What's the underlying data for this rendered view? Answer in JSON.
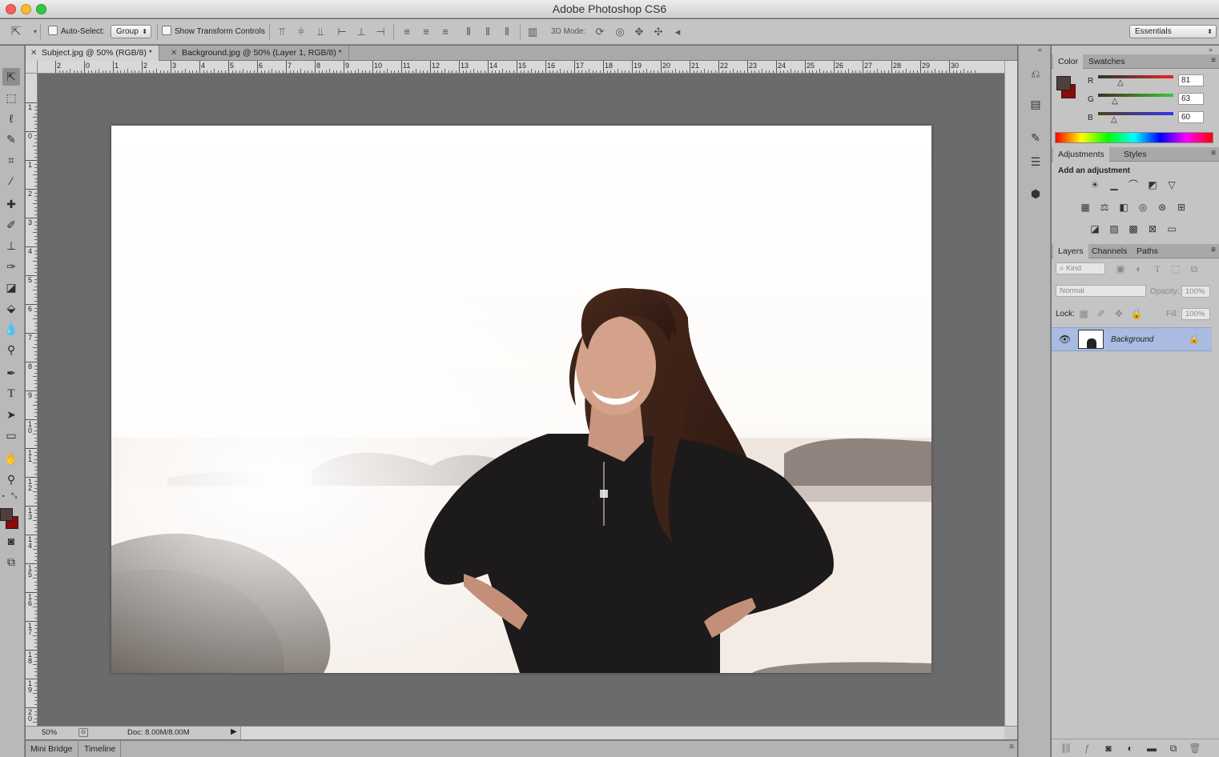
{
  "app": {
    "title": "Adobe Photoshop CS6"
  },
  "options": {
    "auto_select_label": "Auto-Select:",
    "auto_select_value": "Group",
    "show_transform_label": "Show Transform Controls",
    "mode_3d_label": "3D Mode:",
    "workspace": "Essentials"
  },
  "tabs": [
    {
      "label": "Subject.jpg @ 50% (RGB/8) *"
    },
    {
      "label": "Background.jpg @ 50% (Layer 1, RGB/8) *"
    }
  ],
  "ruler": {
    "top": [
      "2",
      "0",
      "1",
      "2",
      "3",
      "4",
      "5",
      "6",
      "7",
      "8",
      "9",
      "10",
      "11",
      "12",
      "13",
      "14",
      "15",
      "16",
      "17",
      "18",
      "19",
      "20",
      "21",
      "22",
      "23",
      "24",
      "25",
      "26",
      "27",
      "28",
      "29",
      "30"
    ],
    "left": [
      "1",
      "0",
      "1",
      "2",
      "3",
      "4",
      "5",
      "6",
      "7",
      "8",
      "9",
      "10",
      "11",
      "12",
      "13",
      "14",
      "15",
      "16",
      "17",
      "18",
      "19",
      "20"
    ]
  },
  "status": {
    "zoom": "50%",
    "doc": "Doc: 8.00M/8.00M"
  },
  "bottom_tabs": [
    "Mini Bridge",
    "Timeline"
  ],
  "color_panel": {
    "tabs": [
      "Color",
      "Swatches"
    ],
    "channels": [
      {
        "label": "R",
        "value": "81"
      },
      {
        "label": "G",
        "value": "63"
      },
      {
        "label": "B",
        "value": "60"
      }
    ],
    "foreground": "#513f3c",
    "background": "#8b0a0a"
  },
  "adjustments_panel": {
    "tabs": [
      "Adjustments",
      "Styles"
    ],
    "heading": "Add an adjustment"
  },
  "layers_panel": {
    "tabs": [
      "Layers",
      "Channels",
      "Paths"
    ],
    "filter_kind": "Kind",
    "blend_mode": "Normal",
    "opacity_label": "Opacity:",
    "opacity_value": "100%",
    "lock_label": "Lock:",
    "fill_label": "Fill:",
    "fill_value": "100%",
    "layers": [
      {
        "name": "Background"
      }
    ]
  }
}
